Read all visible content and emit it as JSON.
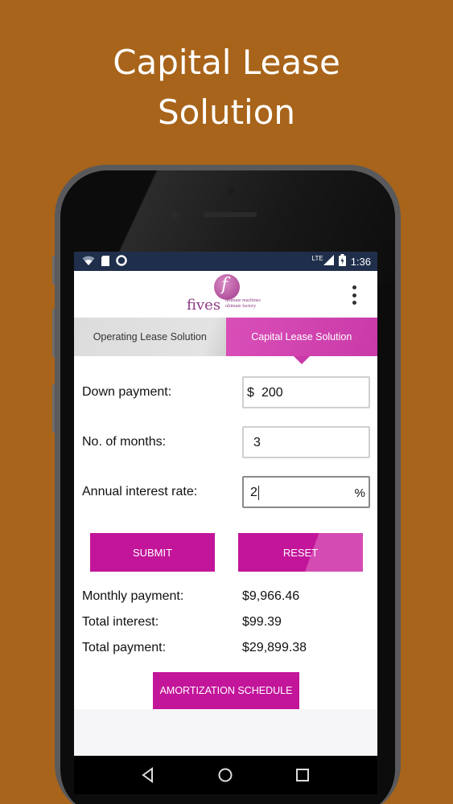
{
  "headline": {
    "line1": "Capital Lease",
    "line2": "Solution"
  },
  "status_bar": {
    "time": "1:36",
    "network": "LTE",
    "icons": [
      "wifi-icon",
      "sim-card-icon",
      "circle-icon",
      "signal-icon",
      "battery-icon"
    ]
  },
  "logo": {
    "letter": "f",
    "word": "fives",
    "tagline_1": "ultimate machines",
    "tagline_2": "ultimate factory"
  },
  "tabs": [
    {
      "label": "Operating Lease Solution",
      "selected": false
    },
    {
      "label": "Capital Lease Solution",
      "selected": true
    }
  ],
  "form": {
    "down_payment": {
      "label": "Down payment:",
      "prefix": "$",
      "value": "200"
    },
    "months": {
      "label": "No. of months:",
      "value": "3"
    },
    "interest": {
      "label": "Annual interest rate:",
      "value": "2",
      "suffix": "%"
    }
  },
  "buttons": {
    "submit": "SUBMIT",
    "reset": "RESET",
    "amortization": "AMORTIZATION SCHEDULE"
  },
  "results": {
    "monthly": {
      "label": "Monthly payment:",
      "value": "$9,966.46"
    },
    "interest": {
      "label": "Total interest:",
      "value": "$99.39"
    },
    "total": {
      "label": "Total payment:",
      "value": "$29,899.38"
    }
  },
  "colors": {
    "background": "#a8641a",
    "accent": "#c2159a",
    "tab_active": "#c93aa8",
    "status_bar": "#1f2e4a"
  }
}
